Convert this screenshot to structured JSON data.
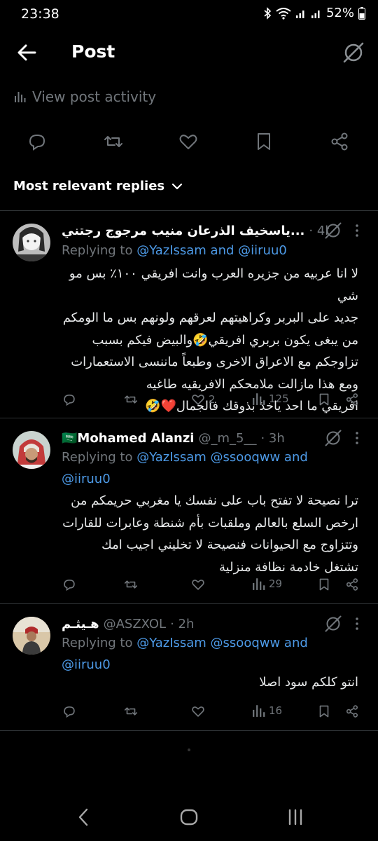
{
  "status": {
    "time": "23:38",
    "battery": "52%"
  },
  "appbar": {
    "title": "Post"
  },
  "activity": {
    "label": "View post activity"
  },
  "replies_header": {
    "label": "Most relevant replies"
  },
  "replies": [
    {
      "name": "ياسخيف الذرعان منيب مرجوج رجتني...",
      "handle": "",
      "time": "· 4h",
      "replying_prefix": "Replying to ",
      "mentions": "@YazIssam and @iiruu0",
      "lines": [
        "لا انا عربيه من جزيره العرب وانت افريقي ١٠٠٪ بس مو شي",
        "جديد على البربر وكراهيتهم لعرقهم ولونهم بس ما الومكم",
        "من يبغى يكون بربري افريقي🤣والبيض فيكم بسبب",
        "تزاوجكم مع الاعراق الاخرى وطبعاً ماننسى الاستعمارات",
        "ومع هذا مازالت ملامحكم الافريقيه طاغيه",
        "افريقي ما احد ياخذ بذوقك فالجمال❤️🤣"
      ],
      "likes": "2",
      "views": "125"
    },
    {
      "name": "🇸🇦Mohamed Alanzi",
      "handle": "@_m_5__",
      "time": "· 3h",
      "replying_prefix": "Replying to ",
      "mentions": "@YazIssam @ssooqww and",
      "mentions2": "@iiruu0",
      "lines": [
        "ترا نصيحة لا تفتح باب على نفسك يا مغربي حريمكم من",
        "ارخص السلع بالعالم وملقبات بأم شنطة وعابرات للقارات",
        "وتتزاوج مع الحيوانات فنصيحة لا تخليني اجيب امك",
        "تشتغل خادمة نظافة منزلية"
      ],
      "likes": "",
      "views": "29"
    },
    {
      "name": "هـيثـم",
      "handle": "@ASZXOL",
      "time": "· 2h",
      "replying_prefix": "Replying to ",
      "mentions": "@YazIssam @ssooqww and",
      "mentions2": "@iiruu0",
      "lines": [
        "انتو كلكم سود اصلا"
      ],
      "likes": "",
      "views": "16"
    }
  ],
  "icons": {
    "back": "arrow-left-icon",
    "grok": "grok-icon",
    "reply": "reply-icon",
    "retweet": "retweet-icon",
    "like": "heart-icon",
    "bookmark": "bookmark-icon",
    "share": "share-icon",
    "views": "views-icon",
    "more": "more-icon"
  },
  "colors": {
    "background": "#000000",
    "accent": "#4d9ae7",
    "muted": "#71767b",
    "text": "#e7e9ea"
  }
}
